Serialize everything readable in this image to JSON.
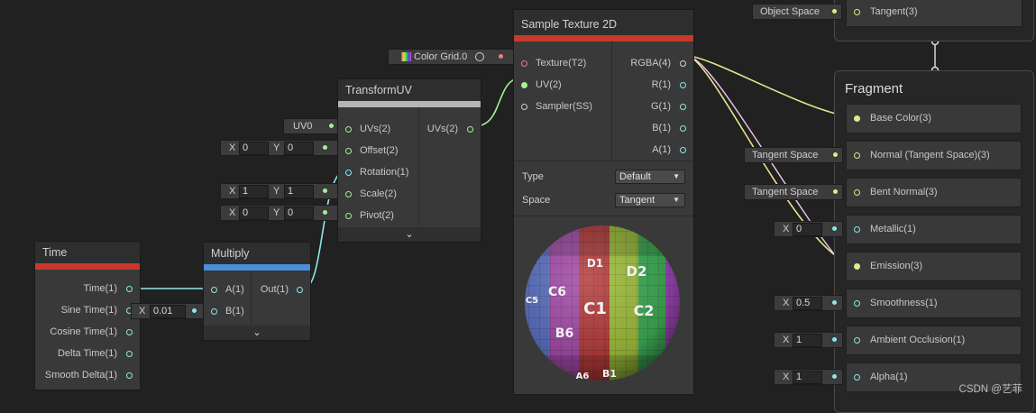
{
  "colors": {
    "time_bar": "#c8392b",
    "multiply_bar": "#4a8fd8",
    "transform_bar": "#b5b5b5",
    "sample_bar": "#c8392b",
    "vector1_port": "#8fe8e8",
    "vector2_port": "#a6ee9a",
    "vector3_port": "#e4e88a",
    "vector4_port": "#f0c4ec",
    "texture_port": "#ef7d7d"
  },
  "time_node": {
    "title": "Time",
    "outputs": [
      "Time(1)",
      "Sine Time(1)",
      "Cosine Time(1)",
      "Delta Time(1)",
      "Smooth Delta(1)"
    ]
  },
  "multiply_node": {
    "title": "Multiply",
    "inputs": [
      "A(1)",
      "B(1)"
    ],
    "output": "Out(1)",
    "b_value_label": "X",
    "b_value": "0.01"
  },
  "transform_node": {
    "title": "TransformUV",
    "inputs": [
      "UVs(2)",
      "Offset(2)",
      "Rotation(1)",
      "Scale(2)",
      "Pivot(2)"
    ],
    "output": "UVs(2)",
    "uv_pill": "UV0",
    "offset": {
      "x_label": "X",
      "x": "0",
      "y_label": "Y",
      "y": "0"
    },
    "scale": {
      "x_label": "X",
      "x": "1",
      "y_label": "Y",
      "y": "1"
    },
    "pivot": {
      "x_label": "X",
      "x": "0",
      "y_label": "Y",
      "y": "0"
    }
  },
  "sample_node": {
    "title": "Sample Texture 2D",
    "inputs": [
      "Texture(T2)",
      "UV(2)",
      "Sampler(SS)"
    ],
    "outputs": [
      "RGBA(4)",
      "R(1)",
      "G(1)",
      "B(1)",
      "A(1)"
    ],
    "texture_pill": "Color Grid.0",
    "type_label": "Type",
    "type_value": "Default",
    "space_label": "Space",
    "space_value": "Tangent",
    "preview_cells": [
      "C1",
      "C2",
      "D1",
      "D2",
      "C6",
      "B6",
      "A6",
      "B1",
      "C5"
    ]
  },
  "vertex_tail": {
    "pill": "Object Space",
    "row": "Tangent(3)"
  },
  "fragment": {
    "title": "Fragment",
    "rows": [
      {
        "label": "Base Color(3)",
        "pill": ""
      },
      {
        "label": "Normal (Tangent Space)(3)",
        "pill": "Tangent Space"
      },
      {
        "label": "Bent Normal(3)",
        "pill": "Tangent Space"
      },
      {
        "label": "Metallic(1)",
        "pill": "X",
        "value": "0"
      },
      {
        "label": "Emission(3)",
        "pill": ""
      },
      {
        "label": "Smoothness(1)",
        "pill": "X",
        "value": "0.5"
      },
      {
        "label": "Ambient Occlusion(1)",
        "pill": "X",
        "value": "1"
      },
      {
        "label": "Alpha(1)",
        "pill": "X",
        "value": "1"
      }
    ]
  },
  "watermark": "CSDN @艺菲"
}
